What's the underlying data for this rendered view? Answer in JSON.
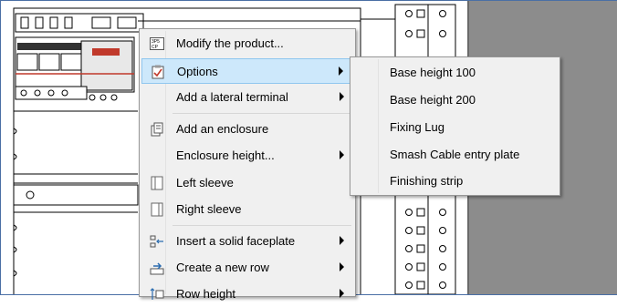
{
  "menu": {
    "items": [
      {
        "label": "Modify the product...",
        "icon": "product-icon",
        "submenu": false
      },
      {
        "label": "Options",
        "icon": "checklist-icon",
        "submenu": true,
        "highlighted": true
      },
      {
        "label": "Add a lateral terminal",
        "icon": "",
        "submenu": true
      },
      {
        "label": "Add an enclosure",
        "icon": "enclosure-icon",
        "submenu": false
      },
      {
        "label": "Enclosure height...",
        "icon": "",
        "submenu": true
      },
      {
        "label": "Left sleeve",
        "icon": "left-sleeve-icon",
        "submenu": false
      },
      {
        "label": "Right sleeve",
        "icon": "right-sleeve-icon",
        "submenu": false
      },
      {
        "label": "Insert a solid faceplate",
        "icon": "faceplate-icon",
        "submenu": true
      },
      {
        "label": "Create a new row",
        "icon": "new-row-icon",
        "submenu": true
      },
      {
        "label": "Row height",
        "icon": "row-height-icon",
        "submenu": true
      }
    ]
  },
  "submenu": {
    "items": [
      {
        "label": "Base height 100"
      },
      {
        "label": "Base height 200"
      },
      {
        "label": "Fixing Lug"
      },
      {
        "label": "Smash Cable entry plate"
      },
      {
        "label": "Finishing strip"
      }
    ]
  },
  "colors": {
    "highlight": "#cde8fb",
    "highlight_border": "#8fc6ef",
    "menu_bg": "#f0f0f0",
    "side_panel": "#8c8c8c"
  }
}
